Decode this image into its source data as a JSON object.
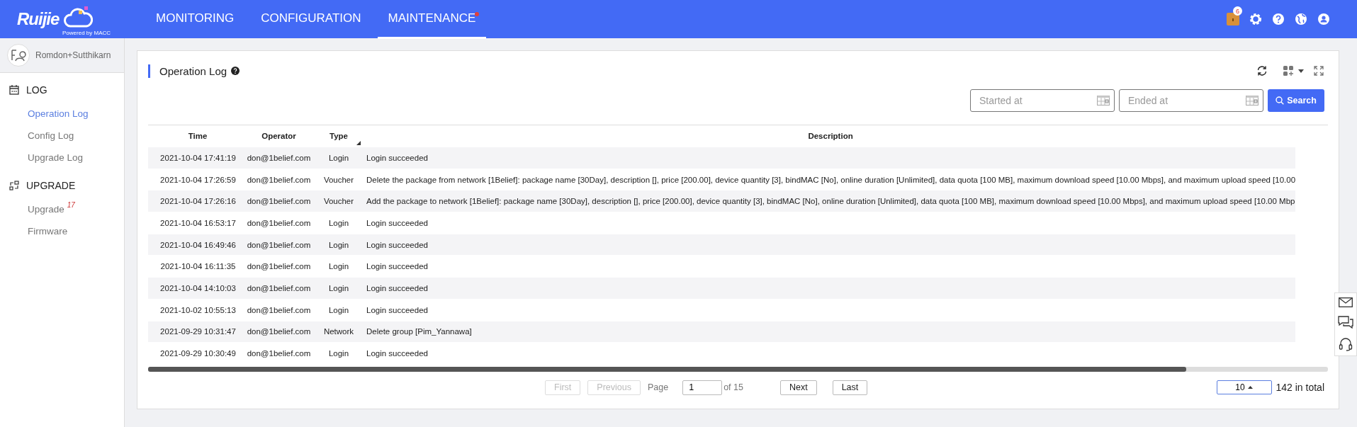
{
  "header": {
    "logo": {
      "brand": "Ruijie",
      "tagline": "Powered by MACC"
    },
    "nav": [
      {
        "label": "MONITORING",
        "selected": false,
        "dot": false
      },
      {
        "label": "CONFIGURATION",
        "selected": false,
        "dot": false
      },
      {
        "label": "MAINTENANCE",
        "selected": true,
        "dot": true
      }
    ],
    "notification_count": "6"
  },
  "sidebar": {
    "account": "Romdon+Sutthikarn",
    "groups": [
      {
        "label": "LOG",
        "kind": "log",
        "items": [
          {
            "label": "Operation Log",
            "selected": true
          },
          {
            "label": "Config Log",
            "selected": false
          },
          {
            "label": "Upgrade Log",
            "selected": false
          }
        ]
      },
      {
        "label": "UPGRADE",
        "kind": "upgrade",
        "items": [
          {
            "label": "Upgrade",
            "selected": false,
            "badge": "17"
          },
          {
            "label": "Firmware",
            "selected": false
          }
        ]
      }
    ]
  },
  "panel": {
    "title": "Operation Log",
    "filters": {
      "start": {
        "placeholder": "Started at"
      },
      "end": {
        "placeholder": "Ended at"
      },
      "button": "Search"
    },
    "table": {
      "columns": [
        "Time",
        "Operator",
        "Type",
        "Description"
      ],
      "rows": [
        {
          "time": "2021-10-04 17:41:19",
          "operator": "don@1belief.com",
          "type": "Login",
          "description": "Login succeeded"
        },
        {
          "time": "2021-10-04 17:26:59",
          "operator": "don@1belief.com",
          "type": "Voucher",
          "description": "Delete the package from network [1Belief]: package name [30Day], description [], price [200.00], device quantity [3], bindMAC [No], online duration [Unlimited], data quota [100 MB], maximum download speed [10.00 Mbps], and maximum upload speed [10.00"
        },
        {
          "time": "2021-10-04 17:26:16",
          "operator": "don@1belief.com",
          "type": "Voucher",
          "description": "Add the package to network [1Belief]: package name [30Day], description [], price [200.00], device quantity [3], bindMAC [No], online duration [Unlimited], data quota [100 MB], maximum download speed [10.00 Mbps], and maximum upload speed [10.00 Mbp"
        },
        {
          "time": "2021-10-04 16:53:17",
          "operator": "don@1belief.com",
          "type": "Login",
          "description": "Login succeeded"
        },
        {
          "time": "2021-10-04 16:49:46",
          "operator": "don@1belief.com",
          "type": "Login",
          "description": "Login succeeded"
        },
        {
          "time": "2021-10-04 16:11:35",
          "operator": "don@1belief.com",
          "type": "Login",
          "description": "Login succeeded"
        },
        {
          "time": "2021-10-04 14:10:03",
          "operator": "don@1belief.com",
          "type": "Login",
          "description": "Login succeeded"
        },
        {
          "time": "2021-10-02 10:55:13",
          "operator": "don@1belief.com",
          "type": "Login",
          "description": "Login succeeded"
        },
        {
          "time": "2021-09-29 10:31:47",
          "operator": "don@1belief.com",
          "type": "Network",
          "description": "Delete group [Pim_Yannawa]"
        },
        {
          "time": "2021-09-29 10:30:49",
          "operator": "don@1belief.com",
          "type": "Login",
          "description": "Login succeeded"
        }
      ]
    },
    "pagination": {
      "first": {
        "label": "First",
        "disabled": true
      },
      "previous": {
        "label": "Previous",
        "disabled": true
      },
      "page_label": "Page",
      "page": "1",
      "of": "of 15",
      "next": {
        "label": "Next",
        "disabled": false
      },
      "last": {
        "label": "Last",
        "disabled": false
      },
      "page_size": "10",
      "total": "142 in total"
    }
  }
}
